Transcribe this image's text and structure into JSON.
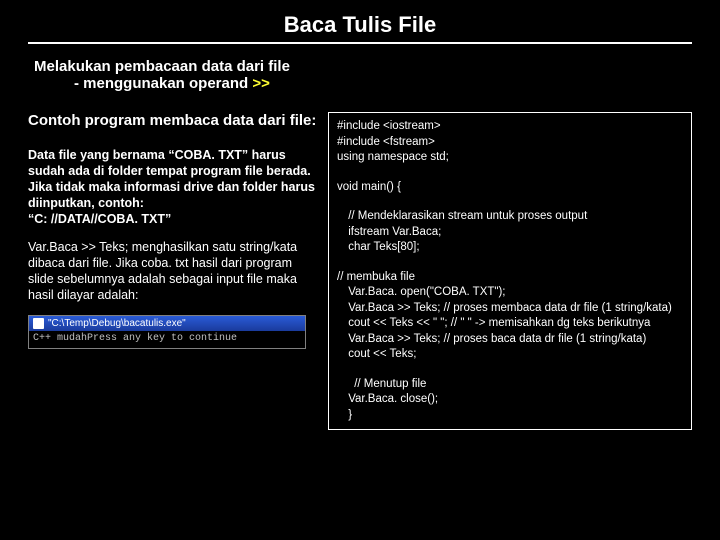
{
  "title": "Baca Tulis File",
  "subtitle_line1": "Melakukan pembacaan data dari file",
  "subtitle_line2_prefix": "- menggunakan operand ",
  "subtitle_line2_op": ">>",
  "left": {
    "heading": "Contoh program membaca data dari file:",
    "para1": "Data file yang bernama “COBA. TXT” harus sudah ada di folder tempat program file berada. Jika tidak maka informasi drive dan folder harus diinputkan, contoh:\n“C: //DATA//COBA. TXT”",
    "para2": "Var.Baca >> Teks; menghasilkan satu string/kata dibaca dari file. Jika coba. txt hasil dari program slide sebelumnya adalah sebagai input file maka hasil dilayar adalah:"
  },
  "console": {
    "titlebar": "\"C:\\Temp\\Debug\\bacatulis.exe\"",
    "body": "C++ mudahPress any key to continue"
  },
  "code": {
    "l01": "#include <iostream>",
    "l02": "#include <fstream>",
    "l03": "using namespace std;",
    "l04": "void main() {",
    "l05": " // Mendeklarasikan stream untuk proses output",
    "l06": " ifstream Var.Baca;",
    "l07": " char Teks[80];",
    "l08": "// membuka file",
    "l09": " Var.Baca. open(\"COBA. TXT\");",
    "l10": " Var.Baca >> Teks; // proses membaca data dr file (1 string/kata)",
    "l11": " cout << Teks << \" \"; // \" \" -> memisahkan dg teks berikutnya",
    "l12": " Var.Baca >> Teks; // proses baca data dr file (1 string/kata)",
    "l13": " cout << Teks;",
    "l14": " // Menutup file",
    "l15": " Var.Baca. close();",
    "l16": " }"
  }
}
